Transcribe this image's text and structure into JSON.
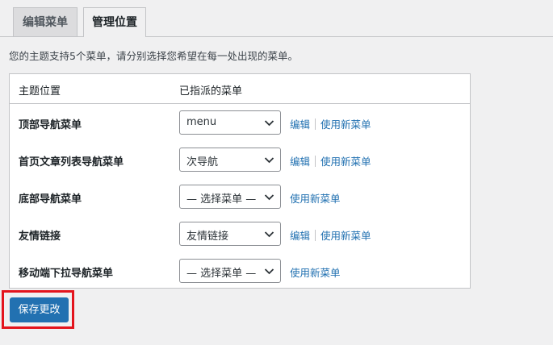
{
  "tabs": [
    {
      "label": "编辑菜单"
    },
    {
      "label": "管理位置"
    }
  ],
  "description": "您的主题支持5个菜单，请分别选择您希望在每一处出现的菜单。",
  "table": {
    "columns": {
      "location": "主题位置",
      "assigned": "已指派的菜单"
    },
    "rows": [
      {
        "location": "顶部导航菜单",
        "selected": "menu",
        "edit": "编辑",
        "new": "使用新菜单"
      },
      {
        "location": "首页文章列表导航菜单",
        "selected": "次导航",
        "edit": "编辑",
        "new": "使用新菜单"
      },
      {
        "location": "底部导航菜单",
        "selected": "— 选择菜单 —",
        "new": "使用新菜单"
      },
      {
        "location": "友情链接",
        "selected": "友情链接",
        "edit": "编辑",
        "new": "使用新菜单"
      },
      {
        "location": "移动端下拉导航菜单",
        "selected": "— 选择菜单 —",
        "new": "使用新菜单"
      }
    ]
  },
  "save_button": "保存更改",
  "colors": {
    "accent": "#2271b1",
    "highlight": "#e3141d"
  }
}
